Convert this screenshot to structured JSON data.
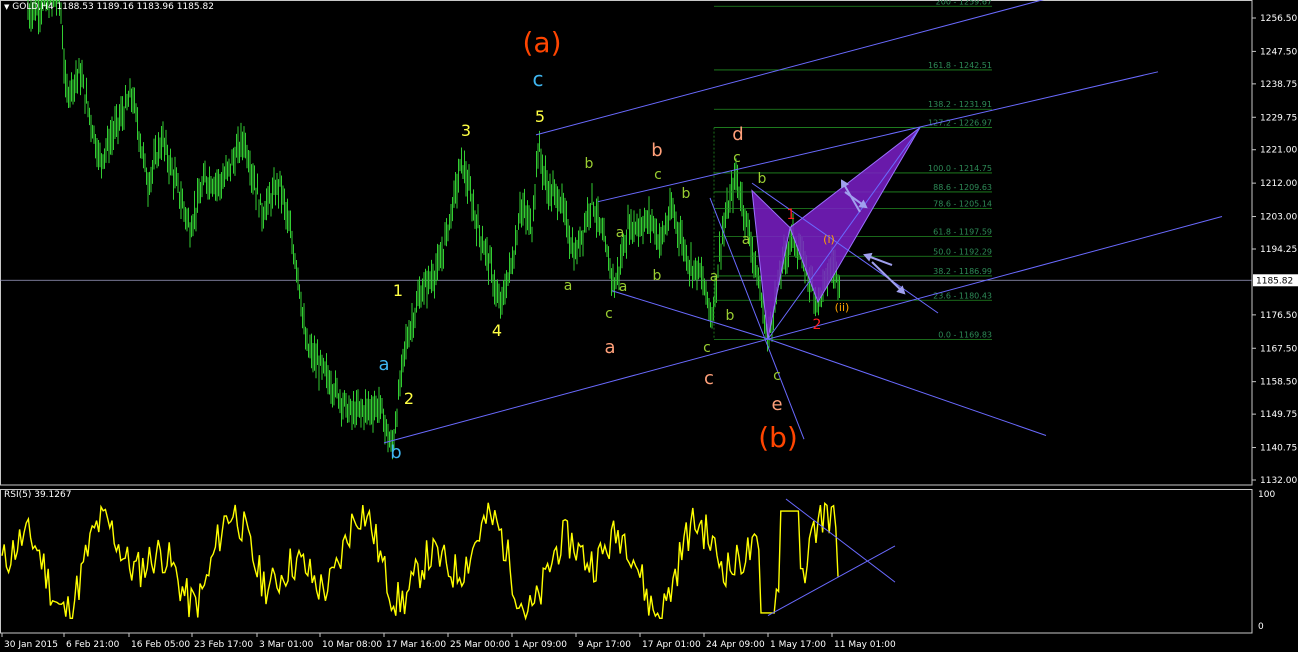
{
  "header": {
    "arrow_icon": "triangle-down-icon",
    "symbol": "GOLD,H4",
    "ohlc": "1188.53 1189.16 1183.96 1185.82"
  },
  "rsi_panel": {
    "title": "RSI(5) 39.1267"
  },
  "chart_data": [
    {
      "type": "candlestick",
      "symbol": "GOLD",
      "timeframe": "H4",
      "current_price": 1185.82,
      "ylim": [
        1132.0,
        1261.0
      ],
      "y_ticks": [
        1256.5,
        1247.5,
        1238.75,
        1229.75,
        1221.0,
        1212.0,
        1203.0,
        1194.25,
        1176.5,
        1167.5,
        1158.5,
        1149.75,
        1140.75,
        1132.0
      ],
      "current_price_label": "1185.82",
      "x_ticks": [
        "30 Jan 2015",
        "6 Feb 21:00",
        "16 Feb 05:00",
        "23 Feb 17:00",
        "3 Mar 01:00",
        "10 Mar 08:00",
        "17 Mar 16:00",
        "25 Mar 00:00",
        "1 Apr 09:00",
        "9 Apr 17:00",
        "17 Apr 01:00",
        "24 Apr 09:00",
        "1 May 17:00",
        "11 May 01:00"
      ],
      "fib_levels": [
        {
          "label": "200 - 1259.67",
          "value": 1259.67
        },
        {
          "label": "161.8 - 1242.51",
          "value": 1242.51
        },
        {
          "label": "138.2 - 1231.91",
          "value": 1231.91
        },
        {
          "label": "127.2 - 1226.97",
          "value": 1226.97
        },
        {
          "label": "100.0 - 1214.75",
          "value": 1214.75
        },
        {
          "label": "88.6 - 1209.63",
          "value": 1209.63
        },
        {
          "label": "78.6 - 1205.14",
          "value": 1205.14
        },
        {
          "label": "61.8 - 1197.59",
          "value": 1197.59
        },
        {
          "label": "50.0 - 1192.29",
          "value": 1192.29
        },
        {
          "label": "38.2 - 1186.99",
          "value": 1186.99
        },
        {
          "label": "23.6 - 1180.43",
          "value": 1180.43
        },
        {
          "label": "0.0 - 1169.83",
          "value": 1169.83
        }
      ],
      "wave_labels": [
        {
          "text": "(a)",
          "color": "#ff4500"
        },
        {
          "text": "c",
          "color": "#3fb6f0"
        },
        {
          "text": "5",
          "color": "#ffff44"
        },
        {
          "text": "3",
          "color": "#ffff44"
        },
        {
          "text": "1",
          "color": "#ffff44"
        },
        {
          "text": "4",
          "color": "#ffff44"
        },
        {
          "text": "2",
          "color": "#ffff44"
        },
        {
          "text": "a",
          "color": "#3fb6f0"
        },
        {
          "text": "b",
          "color": "#3fb6f0"
        },
        {
          "text": "b",
          "color": "#9acd32"
        },
        {
          "text": "c",
          "color": "#9acd32"
        },
        {
          "text": "b",
          "color": "#9acd32"
        },
        {
          "text": "a",
          "color": "#9acd32"
        },
        {
          "text": "a",
          "color": "#9acd32"
        },
        {
          "text": "b",
          "color": "#9acd32"
        },
        {
          "text": "a",
          "color": "#9acd32"
        },
        {
          "text": "c",
          "color": "#9acd32"
        },
        {
          "text": "b",
          "color": "#ffa07a"
        },
        {
          "text": "a",
          "color": "#ffa07a"
        },
        {
          "text": "d",
          "color": "#ffa07a"
        },
        {
          "text": "c",
          "color": "#ffa07a"
        },
        {
          "text": "e",
          "color": "#ffa07a"
        },
        {
          "text": "c",
          "color": "#9acd32"
        },
        {
          "text": "b",
          "color": "#9acd32"
        },
        {
          "text": "a",
          "color": "#9acd32"
        },
        {
          "text": "a",
          "color": "#9acd32"
        },
        {
          "text": "b",
          "color": "#9acd32"
        },
        {
          "text": "c",
          "color": "#9acd32"
        },
        {
          "text": "c",
          "color": "#9acd32"
        },
        {
          "text": "1",
          "color": "#ff2020"
        },
        {
          "text": "2",
          "color": "#ff2020"
        },
        {
          "text": "(i)",
          "color": "#ffa500"
        },
        {
          "text": "(ii)",
          "color": "#ffa500"
        },
        {
          "text": "(b)",
          "color": "#ff4500"
        }
      ],
      "colors": {
        "candles": "#32cd32",
        "trendlines": "#6a6aff",
        "fib": "#228b22",
        "pattern": "#7b1fc8"
      }
    },
    {
      "type": "line",
      "indicator": "RSI",
      "period": 5,
      "current_value": 39.1267,
      "ylim": [
        0,
        100
      ],
      "y_ticks": [
        "100",
        "0"
      ],
      "color": "#ffff00"
    }
  ]
}
